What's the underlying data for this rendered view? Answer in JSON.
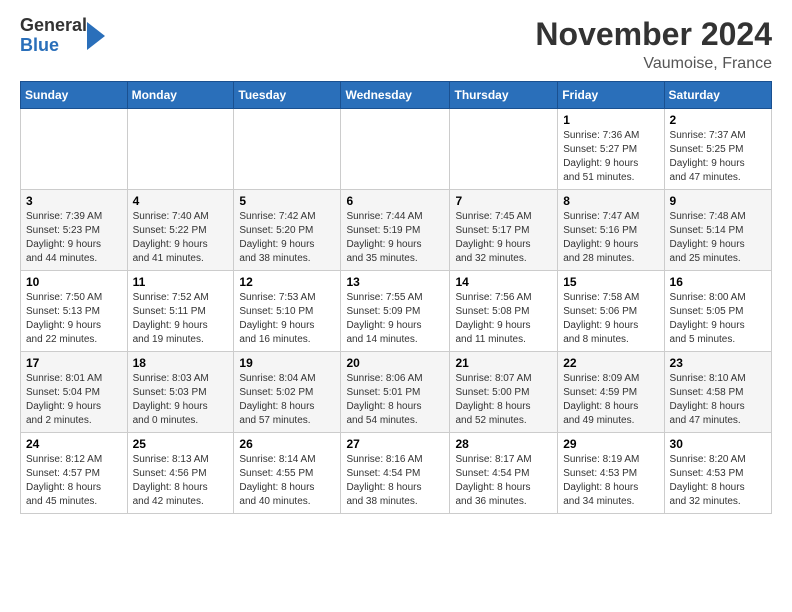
{
  "logo": {
    "text_general": "General",
    "text_blue": "Blue"
  },
  "header": {
    "month": "November 2024",
    "location": "Vaumoise, France"
  },
  "weekdays": [
    "Sunday",
    "Monday",
    "Tuesday",
    "Wednesday",
    "Thursday",
    "Friday",
    "Saturday"
  ],
  "weeks": [
    [
      {
        "day": "",
        "info": ""
      },
      {
        "day": "",
        "info": ""
      },
      {
        "day": "",
        "info": ""
      },
      {
        "day": "",
        "info": ""
      },
      {
        "day": "",
        "info": ""
      },
      {
        "day": "1",
        "info": "Sunrise: 7:36 AM\nSunset: 5:27 PM\nDaylight: 9 hours\nand 51 minutes."
      },
      {
        "day": "2",
        "info": "Sunrise: 7:37 AM\nSunset: 5:25 PM\nDaylight: 9 hours\nand 47 minutes."
      }
    ],
    [
      {
        "day": "3",
        "info": "Sunrise: 7:39 AM\nSunset: 5:23 PM\nDaylight: 9 hours\nand 44 minutes."
      },
      {
        "day": "4",
        "info": "Sunrise: 7:40 AM\nSunset: 5:22 PM\nDaylight: 9 hours\nand 41 minutes."
      },
      {
        "day": "5",
        "info": "Sunrise: 7:42 AM\nSunset: 5:20 PM\nDaylight: 9 hours\nand 38 minutes."
      },
      {
        "day": "6",
        "info": "Sunrise: 7:44 AM\nSunset: 5:19 PM\nDaylight: 9 hours\nand 35 minutes."
      },
      {
        "day": "7",
        "info": "Sunrise: 7:45 AM\nSunset: 5:17 PM\nDaylight: 9 hours\nand 32 minutes."
      },
      {
        "day": "8",
        "info": "Sunrise: 7:47 AM\nSunset: 5:16 PM\nDaylight: 9 hours\nand 28 minutes."
      },
      {
        "day": "9",
        "info": "Sunrise: 7:48 AM\nSunset: 5:14 PM\nDaylight: 9 hours\nand 25 minutes."
      }
    ],
    [
      {
        "day": "10",
        "info": "Sunrise: 7:50 AM\nSunset: 5:13 PM\nDaylight: 9 hours\nand 22 minutes."
      },
      {
        "day": "11",
        "info": "Sunrise: 7:52 AM\nSunset: 5:11 PM\nDaylight: 9 hours\nand 19 minutes."
      },
      {
        "day": "12",
        "info": "Sunrise: 7:53 AM\nSunset: 5:10 PM\nDaylight: 9 hours\nand 16 minutes."
      },
      {
        "day": "13",
        "info": "Sunrise: 7:55 AM\nSunset: 5:09 PM\nDaylight: 9 hours\nand 14 minutes."
      },
      {
        "day": "14",
        "info": "Sunrise: 7:56 AM\nSunset: 5:08 PM\nDaylight: 9 hours\nand 11 minutes."
      },
      {
        "day": "15",
        "info": "Sunrise: 7:58 AM\nSunset: 5:06 PM\nDaylight: 9 hours\nand 8 minutes."
      },
      {
        "day": "16",
        "info": "Sunrise: 8:00 AM\nSunset: 5:05 PM\nDaylight: 9 hours\nand 5 minutes."
      }
    ],
    [
      {
        "day": "17",
        "info": "Sunrise: 8:01 AM\nSunset: 5:04 PM\nDaylight: 9 hours\nand 2 minutes."
      },
      {
        "day": "18",
        "info": "Sunrise: 8:03 AM\nSunset: 5:03 PM\nDaylight: 9 hours\nand 0 minutes."
      },
      {
        "day": "19",
        "info": "Sunrise: 8:04 AM\nSunset: 5:02 PM\nDaylight: 8 hours\nand 57 minutes."
      },
      {
        "day": "20",
        "info": "Sunrise: 8:06 AM\nSunset: 5:01 PM\nDaylight: 8 hours\nand 54 minutes."
      },
      {
        "day": "21",
        "info": "Sunrise: 8:07 AM\nSunset: 5:00 PM\nDaylight: 8 hours\nand 52 minutes."
      },
      {
        "day": "22",
        "info": "Sunrise: 8:09 AM\nSunset: 4:59 PM\nDaylight: 8 hours\nand 49 minutes."
      },
      {
        "day": "23",
        "info": "Sunrise: 8:10 AM\nSunset: 4:58 PM\nDaylight: 8 hours\nand 47 minutes."
      }
    ],
    [
      {
        "day": "24",
        "info": "Sunrise: 8:12 AM\nSunset: 4:57 PM\nDaylight: 8 hours\nand 45 minutes."
      },
      {
        "day": "25",
        "info": "Sunrise: 8:13 AM\nSunset: 4:56 PM\nDaylight: 8 hours\nand 42 minutes."
      },
      {
        "day": "26",
        "info": "Sunrise: 8:14 AM\nSunset: 4:55 PM\nDaylight: 8 hours\nand 40 minutes."
      },
      {
        "day": "27",
        "info": "Sunrise: 8:16 AM\nSunset: 4:54 PM\nDaylight: 8 hours\nand 38 minutes."
      },
      {
        "day": "28",
        "info": "Sunrise: 8:17 AM\nSunset: 4:54 PM\nDaylight: 8 hours\nand 36 minutes."
      },
      {
        "day": "29",
        "info": "Sunrise: 8:19 AM\nSunset: 4:53 PM\nDaylight: 8 hours\nand 34 minutes."
      },
      {
        "day": "30",
        "info": "Sunrise: 8:20 AM\nSunset: 4:53 PM\nDaylight: 8 hours\nand 32 minutes."
      }
    ]
  ]
}
